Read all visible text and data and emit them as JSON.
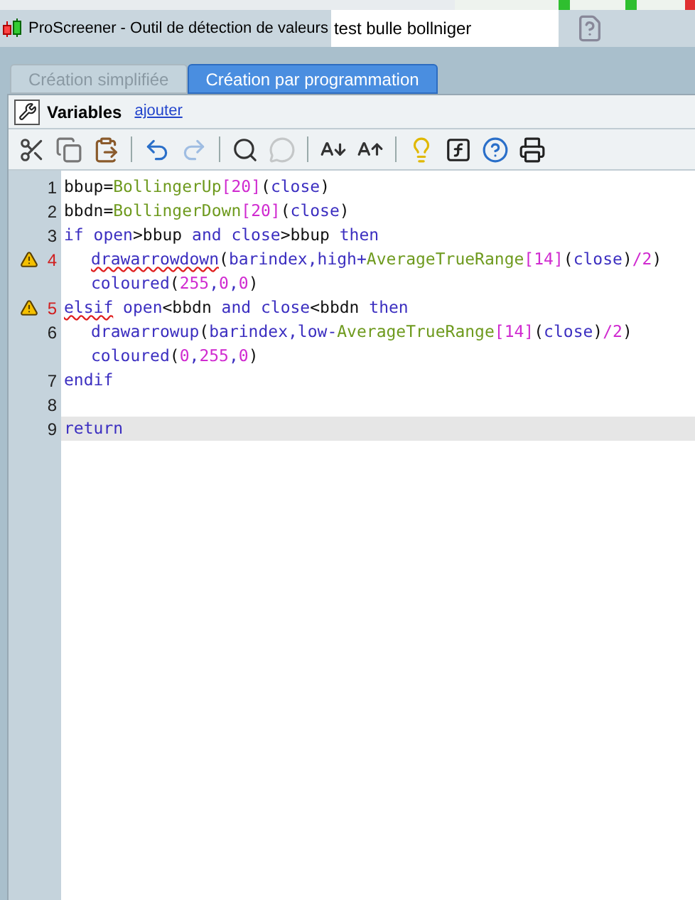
{
  "window": {
    "title": "ProScreener - Outil de détection de valeurs",
    "name_field": "test bulle bollniger"
  },
  "tabs": [
    {
      "label": "Création simplifiée",
      "selected": false
    },
    {
      "label": "Création par programmation",
      "selected": true
    }
  ],
  "variables": {
    "label": "Variables",
    "link": "ajouter"
  },
  "toolbar": [
    {
      "kind": "cut",
      "disabled": false
    },
    {
      "kind": "copy",
      "disabled": false
    },
    {
      "kind": "paste",
      "disabled": false
    },
    {
      "kind": "sep"
    },
    {
      "kind": "undo",
      "disabled": false
    },
    {
      "kind": "redo",
      "disabled": true
    },
    {
      "kind": "sep"
    },
    {
      "kind": "search",
      "disabled": false
    },
    {
      "kind": "comment",
      "disabled": true
    },
    {
      "kind": "sep"
    },
    {
      "kind": "font-smaller",
      "disabled": false
    },
    {
      "kind": "font-larger",
      "disabled": false
    },
    {
      "kind": "sep"
    },
    {
      "kind": "tip",
      "disabled": false
    },
    {
      "kind": "function",
      "disabled": false
    },
    {
      "kind": "help",
      "disabled": false
    },
    {
      "kind": "print",
      "disabled": false
    }
  ],
  "editor": {
    "lines": [
      {
        "number": "1",
        "warning": false,
        "current": false,
        "indent": false,
        "tokens": [
          {
            "text": "bbup=",
            "kind": "plain"
          },
          {
            "text": "BollingerUp",
            "kind": "fn"
          },
          {
            "text": "[20]",
            "kind": "num"
          },
          {
            "text": "(",
            "kind": "plain"
          },
          {
            "text": "close",
            "kind": "kw"
          },
          {
            "text": ")",
            "kind": "plain"
          }
        ]
      },
      {
        "number": "2",
        "warning": false,
        "current": false,
        "indent": false,
        "tokens": [
          {
            "text": "bbdn=",
            "kind": "plain"
          },
          {
            "text": "BollingerDown",
            "kind": "fn"
          },
          {
            "text": "[20]",
            "kind": "num"
          },
          {
            "text": "(",
            "kind": "plain"
          },
          {
            "text": "close",
            "kind": "kw"
          },
          {
            "text": ")",
            "kind": "plain"
          }
        ]
      },
      {
        "number": "3",
        "warning": false,
        "current": false,
        "indent": false,
        "tokens": [
          {
            "text": "if open",
            "kind": "kw"
          },
          {
            "text": ">bbup ",
            "kind": "plain"
          },
          {
            "text": "and close",
            "kind": "kw"
          },
          {
            "text": ">bbup ",
            "kind": "plain"
          },
          {
            "text": "then",
            "kind": "kw"
          }
        ]
      },
      {
        "number": "4",
        "warning": true,
        "current": false,
        "indent": true,
        "tokens": [
          {
            "text": "drawarrowdown",
            "kind": "flagged"
          },
          {
            "text": "(",
            "kind": "plain"
          },
          {
            "text": "barindex,high+",
            "kind": "kw"
          },
          {
            "text": "AverageTrueRange",
            "kind": "fn"
          },
          {
            "text": "[14]",
            "kind": "num"
          },
          {
            "text": "(",
            "kind": "plain"
          },
          {
            "text": "close",
            "kind": "kw"
          },
          {
            "text": ")",
            "kind": "plain"
          },
          {
            "text": "/2",
            "kind": "num"
          },
          {
            "text": ")",
            "kind": "plain"
          }
        ]
      },
      {
        "warning": false,
        "current": false,
        "indent": true,
        "tokens": [
          {
            "text": "coloured",
            "kind": "kw"
          },
          {
            "text": "(",
            "kind": "plain"
          },
          {
            "text": "255",
            "kind": "num"
          },
          {
            "text": ",",
            "kind": "kw"
          },
          {
            "text": "0",
            "kind": "num"
          },
          {
            "text": ",",
            "kind": "kw"
          },
          {
            "text": "0",
            "kind": "num"
          },
          {
            "text": ")",
            "kind": "plain"
          }
        ]
      },
      {
        "number": "5",
        "warning": true,
        "current": false,
        "indent": false,
        "tokens": [
          {
            "text": "elsif",
            "kind": "flagged"
          },
          {
            "text": " open",
            "kind": "kw"
          },
          {
            "text": "<bbdn ",
            "kind": "plain"
          },
          {
            "text": "and close",
            "kind": "kw"
          },
          {
            "text": "<bbdn ",
            "kind": "plain"
          },
          {
            "text": "then",
            "kind": "kw"
          }
        ]
      },
      {
        "number": "6",
        "warning": false,
        "current": false,
        "indent": true,
        "tokens": [
          {
            "text": "drawarrowup",
            "kind": "kw"
          },
          {
            "text": "(",
            "kind": "plain"
          },
          {
            "text": "barindex,low-",
            "kind": "kw"
          },
          {
            "text": "AverageTrueRange",
            "kind": "fn"
          },
          {
            "text": "[14]",
            "kind": "num"
          },
          {
            "text": "(",
            "kind": "plain"
          },
          {
            "text": "close",
            "kind": "kw"
          },
          {
            "text": ")",
            "kind": "plain"
          },
          {
            "text": "/2",
            "kind": "num"
          },
          {
            "text": ")",
            "kind": "plain"
          }
        ]
      },
      {
        "warning": false,
        "current": false,
        "indent": true,
        "tokens": [
          {
            "text": "coloured",
            "kind": "kw"
          },
          {
            "text": "(",
            "kind": "plain"
          },
          {
            "text": "0",
            "kind": "num"
          },
          {
            "text": ",",
            "kind": "kw"
          },
          {
            "text": "255",
            "kind": "num"
          },
          {
            "text": ",",
            "kind": "kw"
          },
          {
            "text": "0",
            "kind": "num"
          },
          {
            "text": ")",
            "kind": "plain"
          }
        ]
      },
      {
        "number": "7",
        "warning": false,
        "current": false,
        "indent": false,
        "tokens": [
          {
            "text": "endif",
            "kind": "kw"
          }
        ]
      },
      {
        "number": "8",
        "warning": false,
        "current": false
      },
      {
        "number": "9",
        "warning": false,
        "current": true,
        "indent": false,
        "tokens": [
          {
            "text": "return",
            "kind": "kw"
          }
        ]
      }
    ]
  }
}
